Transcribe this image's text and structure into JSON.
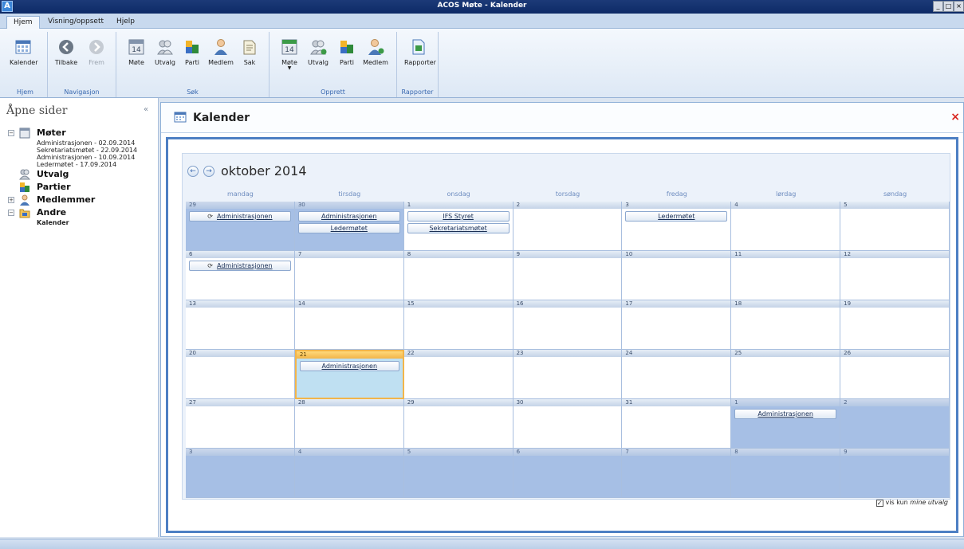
{
  "window": {
    "title": "ACOS Møte - Kalender",
    "app_icon": "A",
    "controls": [
      "_",
      "□",
      "×"
    ]
  },
  "ribbon_tabs": [
    {
      "label": "Hjem",
      "active": true
    },
    {
      "label": "Visning/oppsett",
      "active": false
    },
    {
      "label": "Hjelp",
      "active": false
    }
  ],
  "ribbon": {
    "groups": [
      {
        "label": "Hjem",
        "buttons": [
          {
            "label": "Kalender",
            "icon": "calendar-icon"
          }
        ]
      },
      {
        "label": "Navigasjon",
        "buttons": [
          {
            "label": "Tilbake",
            "icon": "back-arrow-icon"
          },
          {
            "label": "Frem",
            "icon": "forward-arrow-icon",
            "disabled": true
          }
        ]
      },
      {
        "label": "Søk",
        "buttons": [
          {
            "label": "Møte",
            "icon": "meeting-calendar-icon"
          },
          {
            "label": "Utvalg",
            "icon": "committee-icon"
          },
          {
            "label": "Parti",
            "icon": "party-icon"
          },
          {
            "label": "Medlem",
            "icon": "member-icon"
          },
          {
            "label": "Sak",
            "icon": "case-icon"
          }
        ]
      },
      {
        "label": "Opprett",
        "buttons": [
          {
            "label": "Møte",
            "icon": "new-meeting-icon",
            "dropdown": true
          },
          {
            "label": "Utvalg",
            "icon": "new-committee-icon"
          },
          {
            "label": "Parti",
            "icon": "new-party-icon"
          },
          {
            "label": "Medlem",
            "icon": "new-member-icon"
          }
        ]
      },
      {
        "label": "Rapporter",
        "buttons": [
          {
            "label": "Rapporter",
            "icon": "report-icon"
          }
        ]
      }
    ]
  },
  "left_panel": {
    "title": "Åpne sider",
    "collapse": "«",
    "tree": {
      "moter": {
        "label": "Møter",
        "items": [
          "Administrasjonen - 02.09.2014",
          "Sekretariatsmøtet - 22.09.2014",
          "Administrasjonen - 10.09.2014",
          "Ledermøtet - 17.09.2014"
        ]
      },
      "utvalg": {
        "label": "Utvalg"
      },
      "partier": {
        "label": "Partier"
      },
      "medlemmer": {
        "label": "Medlemmer"
      },
      "andre": {
        "label": "Andre",
        "items": [
          "Kalender"
        ]
      }
    }
  },
  "main": {
    "title": "Kalender",
    "close": "×"
  },
  "calendar": {
    "month_label": "oktober 2014",
    "prev": "←",
    "next": "→",
    "day_headers": [
      "mandag",
      "tirsdag",
      "onsdag",
      "torsdag",
      "fredag",
      "lørdag",
      "søndag"
    ],
    "weeks": [
      [
        {
          "day": "29",
          "other": true,
          "events": [
            {
              "title": "Administrasjonen",
              "recurring": true
            }
          ]
        },
        {
          "day": "30",
          "other": true,
          "events": [
            {
              "title": "Administrasjonen"
            },
            {
              "title": "Ledermøtet"
            }
          ]
        },
        {
          "day": "1",
          "events": [
            {
              "title": "IFS Styret"
            },
            {
              "title": "Sekretariatsmøtet"
            }
          ]
        },
        {
          "day": "2",
          "events": []
        },
        {
          "day": "3",
          "events": [
            {
              "title": "Ledermøtet"
            }
          ]
        },
        {
          "day": "4",
          "events": []
        },
        {
          "day": "5",
          "events": []
        }
      ],
      [
        {
          "day": "6",
          "events": [
            {
              "title": "Administrasjonen",
              "recurring": true
            }
          ]
        },
        {
          "day": "7",
          "events": []
        },
        {
          "day": "8",
          "events": []
        },
        {
          "day": "9",
          "events": []
        },
        {
          "day": "10",
          "events": []
        },
        {
          "day": "11",
          "events": []
        },
        {
          "day": "12",
          "events": []
        }
      ],
      [
        {
          "day": "13",
          "events": []
        },
        {
          "day": "14",
          "events": []
        },
        {
          "day": "15",
          "events": []
        },
        {
          "day": "16",
          "events": []
        },
        {
          "day": "17",
          "events": []
        },
        {
          "day": "18",
          "events": []
        },
        {
          "day": "19",
          "events": []
        }
      ],
      [
        {
          "day": "20",
          "events": []
        },
        {
          "day": "21",
          "today": true,
          "events": [
            {
              "title": "Administrasjonen"
            }
          ]
        },
        {
          "day": "22",
          "events": []
        },
        {
          "day": "23",
          "events": []
        },
        {
          "day": "24",
          "events": []
        },
        {
          "day": "25",
          "events": []
        },
        {
          "day": "26",
          "events": []
        }
      ],
      [
        {
          "day": "27",
          "events": []
        },
        {
          "day": "28",
          "events": []
        },
        {
          "day": "29",
          "events": []
        },
        {
          "day": "30",
          "events": []
        },
        {
          "day": "31",
          "events": []
        },
        {
          "day": "1",
          "other": true,
          "events": [
            {
              "title": "Administrasjonen"
            }
          ]
        },
        {
          "day": "2",
          "other": true,
          "events": []
        }
      ],
      [
        {
          "day": "3",
          "other": true,
          "events": []
        },
        {
          "day": "4",
          "other": true,
          "events": []
        },
        {
          "day": "5",
          "other": true,
          "events": []
        },
        {
          "day": "6",
          "other": true,
          "events": []
        },
        {
          "day": "7",
          "other": true,
          "events": []
        },
        {
          "day": "8",
          "other": true,
          "events": []
        },
        {
          "day": "9",
          "other": true,
          "events": []
        }
      ]
    ]
  },
  "filter": {
    "checked": true,
    "check_mark": "✓",
    "label_prefix": "vis kun",
    "label_emphasis": "mine utvalg"
  },
  "colors": {
    "accent": "#4d7fc3",
    "other_month": "#a6bfe5",
    "today_border": "#f2b54a",
    "close": "#d8251e"
  }
}
